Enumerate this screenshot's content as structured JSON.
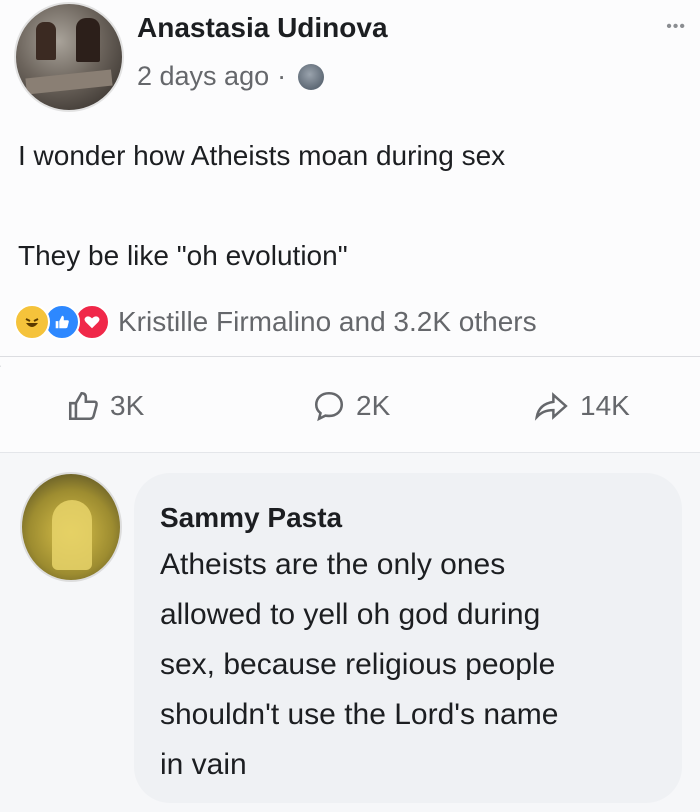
{
  "post": {
    "author": "Anastasia Udinova",
    "time": "2 days ago",
    "separator": "·",
    "more": "•••",
    "text_line1": "I wonder how Atheists moan during sex",
    "text_line2": "They be like \"oh evolution\"",
    "reactions_text": "Kristille Firmalino and 3.2K others",
    "reaction_icons": [
      "haha-icon",
      "like-icon",
      "love-icon"
    ],
    "actions": {
      "like_count": "3K",
      "comment_count": "2K",
      "share_count": "14K"
    }
  },
  "comment": {
    "author": "Sammy Pasta",
    "lines": [
      "Atheists are the only ones",
      "allowed to yell oh god during",
      "sex, because religious people",
      "shouldn't use the Lord's name",
      "in vain"
    ]
  },
  "colors": {
    "like_blue": "#2d88ff",
    "love_red": "#f02849",
    "haha_yellow": "#f5c33b",
    "secondary_text": "#65676b"
  }
}
